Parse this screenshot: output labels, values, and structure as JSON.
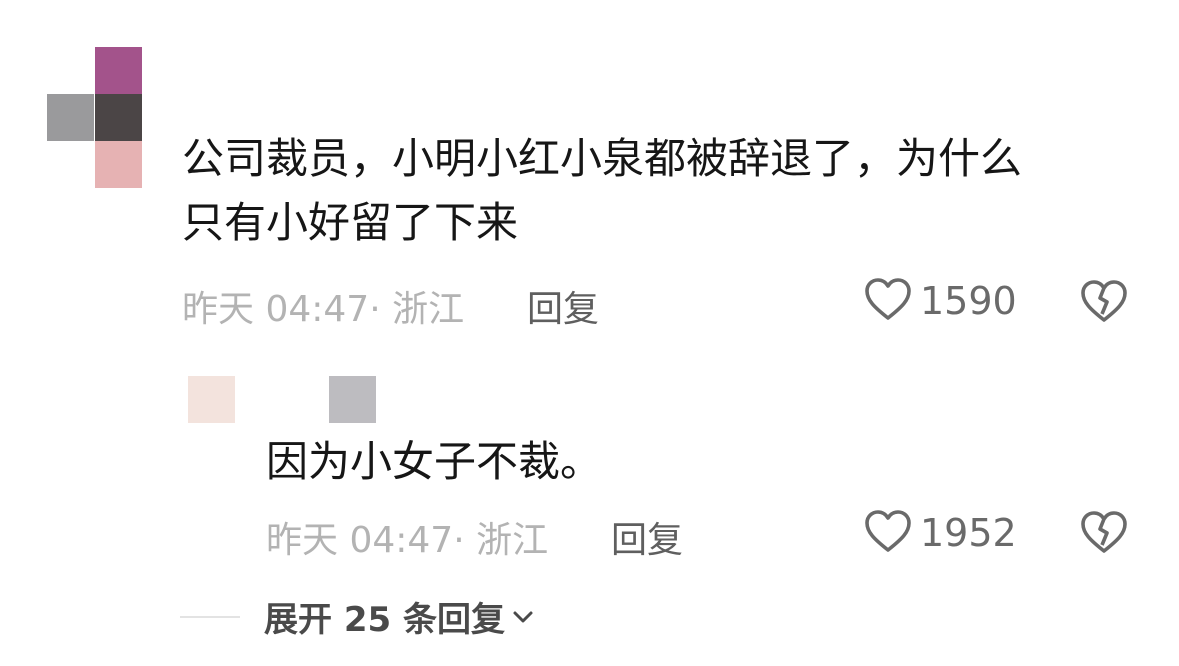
{
  "comment": {
    "text_line1": "公司裁员，小明小红小泉都被辞退了，为什么",
    "text_line2": "只有小好留了下来",
    "meta": "昨天 04:47· 浙江",
    "reply_label": "回复",
    "like_count": "1590",
    "avatar_colors": [
      "#a3538b",
      "#9a9a9c",
      "#4b4546",
      "#e6b2b3"
    ]
  },
  "reply": {
    "text": "因为小女子不裁。",
    "meta": "昨天 04:47· 浙江",
    "reply_label": "回复",
    "like_count": "1952",
    "avatar_colors": [
      "#f3e3dd",
      "#bdbcc0"
    ]
  },
  "expand": {
    "label": "展开 25 条回复"
  },
  "icons": {
    "like": "heart-outline-icon",
    "dislike": "broken-heart-icon",
    "expand": "chevron-down-icon"
  }
}
